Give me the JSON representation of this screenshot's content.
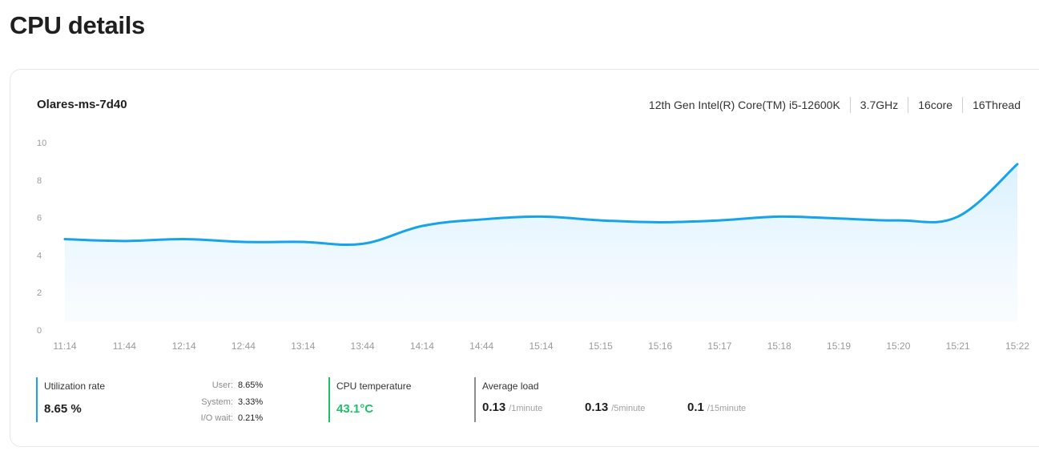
{
  "page": {
    "title": "CPU details"
  },
  "host": {
    "name": "Olares-ms-7d40",
    "specs": [
      "12th Gen Intel(R) Core(TM) i5-12600K",
      "3.7GHz",
      "16core",
      "16Thread"
    ]
  },
  "chart_data": {
    "type": "area",
    "x": [
      "11:14",
      "11:44",
      "12:14",
      "12:44",
      "13:14",
      "13:44",
      "14:14",
      "14:44",
      "15:14",
      "15:15",
      "15:16",
      "15:17",
      "15:18",
      "15:19",
      "15:20",
      "15:21",
      "15:22"
    ],
    "series": [
      {
        "values": [
          4.85,
          4.75,
          4.85,
          4.7,
          4.7,
          4.6,
          5.55,
          5.9,
          6.05,
          5.85,
          5.75,
          5.85,
          6.05,
          5.95,
          5.85,
          6.05,
          8.85
        ]
      }
    ],
    "ylim": [
      0,
      10
    ],
    "yticks": [
      "0",
      "2",
      "4",
      "6",
      "8",
      "10"
    ],
    "grid": false,
    "colors": {
      "line": "#16a3ec",
      "fill_top": "#d6efff",
      "fill_bottom": "#f6fbff"
    }
  },
  "metrics": {
    "utilization": {
      "label": "Utilization rate",
      "value": "8.65 %",
      "breakdown": [
        {
          "name": "User:",
          "value": "8.65%"
        },
        {
          "name": "System:",
          "value": "3.33%"
        },
        {
          "name": "I/O wait:",
          "value": "0.21%"
        }
      ]
    },
    "temperature": {
      "label": "CPU temperature",
      "value": "43.1°C"
    },
    "load": {
      "label": "Average load",
      "items": [
        {
          "value": "0.13",
          "unit": "/1minute"
        },
        {
          "value": "0.13",
          "unit": "/5minute"
        },
        {
          "value": "0.1",
          "unit": "/15minute"
        }
      ]
    }
  },
  "colors": {
    "utilization_accent": "#1aa0ee",
    "temperature_accent": "#1fc06a",
    "load_accent": "#8c8c8c"
  }
}
